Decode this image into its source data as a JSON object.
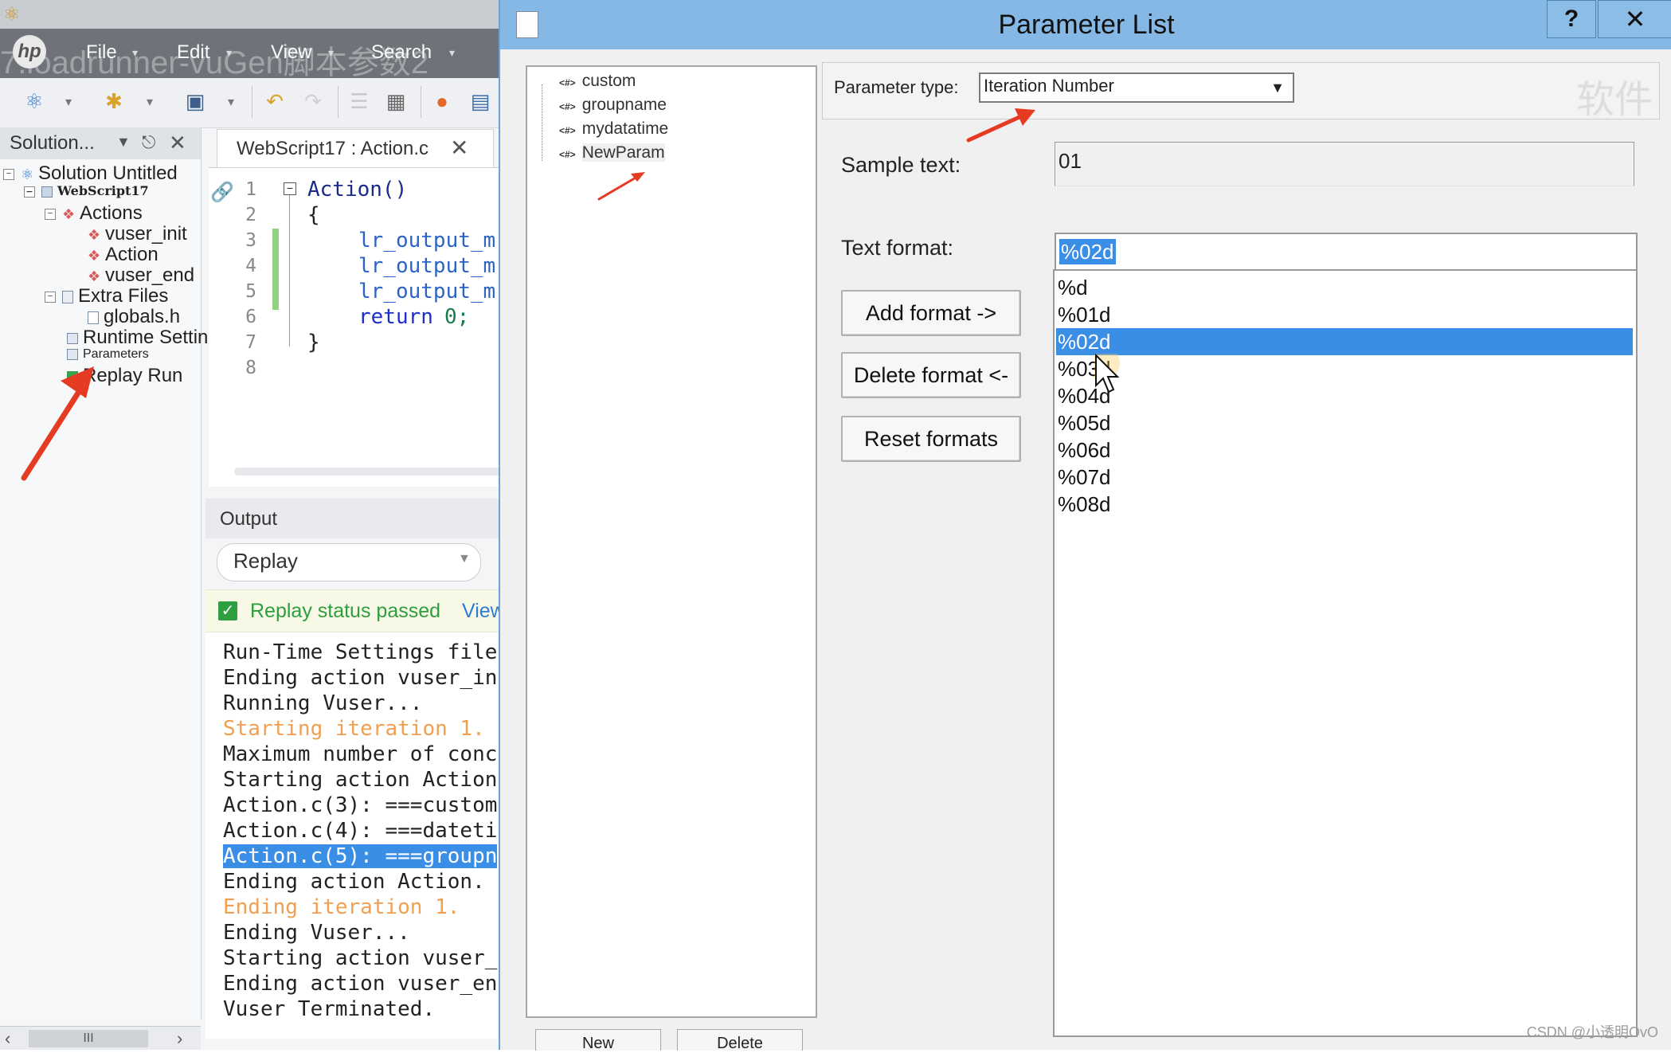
{
  "ide": {
    "menu_bg_title": "7.loadrunner-vuGen脚本参数2",
    "menu": [
      "File",
      "Edit",
      "View",
      "Search"
    ],
    "solution_panel": {
      "title": "Solution...",
      "tree": {
        "solution": "Solution Untitled",
        "script": "WebScript17",
        "actions": "Actions",
        "vuser_init": "vuser_init",
        "action": "Action",
        "vuser_end": "vuser_end",
        "extra_files": "Extra Files",
        "globals": "globals.h",
        "runtime": "Runtime Settings",
        "parameters": "Parameters",
        "replay_run": "Replay Run"
      }
    },
    "editor": {
      "tab_label": "WebScript17 : Action.c",
      "line_numbers": [
        "1",
        "2",
        "3",
        "4",
        "5",
        "6",
        "7",
        "8"
      ],
      "lines": {
        "l1": "Action()",
        "l2": "{",
        "l3": "lr_output_m",
        "l4": "lr_output_m",
        "l5": "lr_output_m",
        "l6_kw": "return",
        "l6_val": "0;",
        "l7": "}"
      }
    },
    "output": {
      "title": "Output",
      "dropdown_value": "Replay",
      "status_text": "Replay status passed",
      "status_link": "View",
      "log": [
        "Run-Time Settings file",
        "Ending action vuser_in",
        "Running Vuser...",
        "Starting iteration 1.",
        "Maximum number of conc",
        "Starting action Action",
        "Action.c(3): ===custom",
        "Action.c(4): ===dateti",
        "Action.c(5): ===groupn",
        "Ending action Action.",
        "Ending iteration 1.",
        "Ending Vuser...",
        "Starting action vuser_",
        "Ending action vuser_en",
        "Vuser Terminated."
      ]
    },
    "scrollbar_thumb": "III"
  },
  "dialog": {
    "title": "Parameter List",
    "help_label": "?",
    "close_label": "✕",
    "params": [
      "custom",
      "groupname",
      "mydatatime",
      "NewParam"
    ],
    "param_type_label": "Parameter type:",
    "param_type_value": "Iteration Number",
    "sample_text_label": "Sample text:",
    "sample_text_value": "01",
    "text_format_label": "Text format:",
    "text_format_value": "%02d",
    "formats": [
      "%d",
      "%01d",
      "%02d",
      "%03d",
      "%04d",
      "%05d",
      "%06d",
      "%07d",
      "%08d"
    ],
    "selected_format_index": 2,
    "buttons": {
      "add": "Add format ->",
      "delete": "Delete format <-",
      "reset": "Reset formats"
    },
    "bottom_buttons": [
      "New",
      "Delete"
    ]
  },
  "overlay": {
    "faded_corner_text": "软件",
    "watermark": "CSDN @小透明OvO"
  },
  "colors": {
    "dialog_title_bg": "#85b8e4",
    "selection": "#3a8ee6",
    "annotation_arrow": "#e53b23",
    "status_green": "#2e9e3e",
    "log_orange": "#f0a050"
  }
}
